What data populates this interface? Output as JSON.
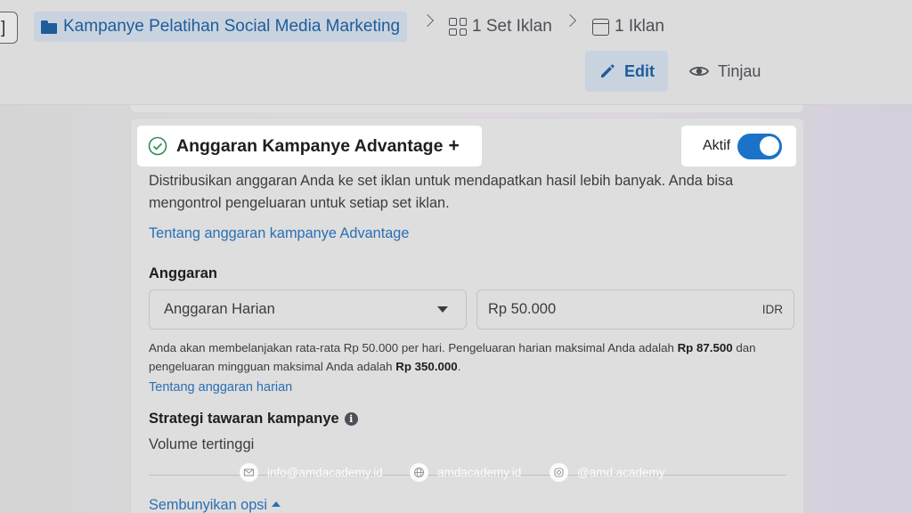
{
  "breadcrumb": {
    "campaign": "Kampanye Pelatihan Social Media Marketing",
    "ad_set": "1 Set Iklan",
    "ad": "1 Iklan"
  },
  "header": {
    "edit_label": "Edit",
    "review_label": "Tinjau"
  },
  "budget_card": {
    "title": "Anggaran Kampanye Advantage",
    "toggle_label": "Aktif",
    "toggle_on": true,
    "description": "Distribusikan anggaran Anda ke set iklan untuk mendapatkan hasil lebih banyak. Anda bisa mengontrol pengeluaran untuk setiap set iklan.",
    "about_link": "Tentang anggaran kampanye Advantage",
    "budget_label": "Anggaran",
    "budget_type": "Anggaran Harian",
    "amount": "Rp 50.000",
    "currency": "IDR",
    "note_part1": "Anda akan membelanjakan rata-rata Rp 50.000 per hari. Pengeluaran harian maksimal Anda adalah ",
    "note_daily_max": "Rp 87.500",
    "note_part2": " dan pengeluaran mingguan maksimal Anda adalah ",
    "note_weekly_max": "Rp 350.000",
    "note_part3": ".",
    "daily_link": "Tentang anggaran harian",
    "strategy_label": "Strategi tawaran kampanye",
    "strategy_value": "Volume tertinggi",
    "hide_options": "Sembunyikan opsi"
  },
  "watermark": {
    "email": "info@amdacademy.id",
    "website": "amdacademy.id",
    "instagram": "@amd.academy"
  },
  "colors": {
    "accent": "#1f5c9a",
    "link": "#2a6fb5",
    "toggle": "#1a73c9"
  }
}
